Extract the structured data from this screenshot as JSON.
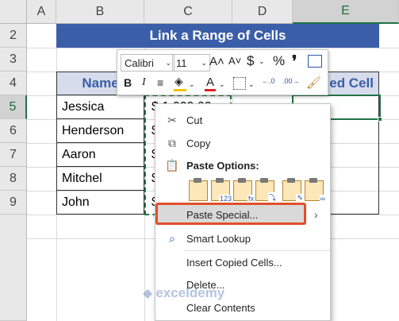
{
  "columns": [
    "A",
    "B",
    "C",
    "D",
    "E"
  ],
  "rows": [
    "2",
    "3",
    "4",
    "5",
    "6",
    "7",
    "8",
    "9"
  ],
  "selected_column": "E",
  "selected_row": "5",
  "title": "Link a Range of Cells",
  "header_name": "Name",
  "header_linked_partial": "ed Cell",
  "names": [
    "Jessica",
    "Henderson",
    "Aaron",
    "Mitchel",
    "John"
  ],
  "amount_visible": "$ 1,000.00",
  "dollar_sign": "$",
  "mini_toolbar": {
    "font": "Calibri",
    "size": "11",
    "bold": "B",
    "italic": "I",
    "font_color": "A",
    "grow": "A˄",
    "shrink": "A˅",
    "currency": "$",
    "percent": "%",
    "comma": "❜"
  },
  "menu": {
    "cut": "Cut",
    "copy": "Copy",
    "paste_options": "Paste Options:",
    "paste_special": "Paste Special...",
    "smart_lookup": "Smart Lookup",
    "insert_copied": "Insert Copied Cells...",
    "delete": "Delete...",
    "clear_contents": "Clear Contents"
  },
  "watermark": "exceldemy",
  "accent_green": "#217346",
  "title_blue": "#3b5ea8",
  "highlight_orange": "#e0502a"
}
